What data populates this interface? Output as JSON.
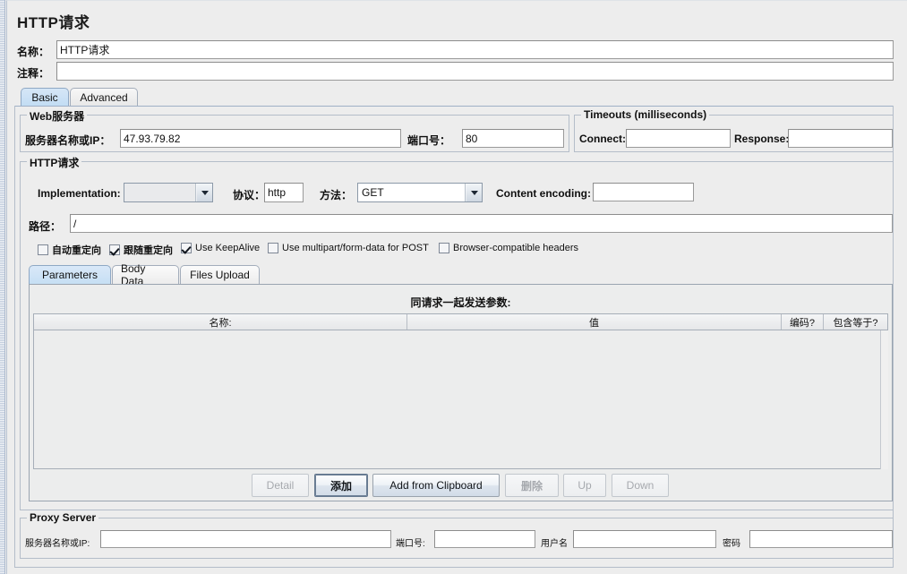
{
  "window": {
    "title": "HTTP请求"
  },
  "header": {
    "name_label": "名称：",
    "name_value": "HTTP请求",
    "comment_label": "注释：",
    "comment_value": ""
  },
  "tabs": [
    {
      "label": "Basic",
      "selected": true
    },
    {
      "label": "Advanced",
      "selected": false
    }
  ],
  "web_server": {
    "legend": "Web服务器",
    "server_label": "服务器名称或IP：",
    "server_value": "47.93.79.82",
    "port_label": "端口号：",
    "port_value": "80"
  },
  "timeouts": {
    "legend": "Timeouts (milliseconds)",
    "connect_label": "Connect:",
    "connect_value": "",
    "response_label": "Response:",
    "response_value": ""
  },
  "http_request": {
    "legend": "HTTP请求",
    "implementation_label": "Implementation:",
    "implementation_value": "",
    "protocol_label": "协议：",
    "protocol_value": "http",
    "method_label": "方法：",
    "method_value": "GET",
    "content_encoding_label": "Content encoding:",
    "content_encoding_value": "",
    "path_label": "路径：",
    "path_value": "/",
    "checkboxes": [
      {
        "label": "自动重定向",
        "checked": false,
        "cn": true
      },
      {
        "label": "跟随重定向",
        "checked": true,
        "cn": true
      },
      {
        "label": "Use KeepAlive",
        "checked": true,
        "cn": false
      },
      {
        "label": "Use multipart/form-data for POST",
        "checked": false,
        "cn": false
      },
      {
        "label": "Browser-compatible headers",
        "checked": false,
        "cn": false
      }
    ]
  },
  "param_tabs": [
    {
      "label": "Parameters",
      "selected": true
    },
    {
      "label": "Body Data",
      "selected": false
    },
    {
      "label": "Files Upload",
      "selected": false
    }
  ],
  "param_table": {
    "title": "同请求一起发送参数:",
    "columns": [
      "名称:",
      "值",
      "编码?",
      "包含等于?"
    ],
    "rows": []
  },
  "table_buttons": [
    {
      "label": "Detail",
      "enabled": false,
      "focused": false,
      "cn": false
    },
    {
      "label": "添加",
      "enabled": true,
      "focused": true,
      "cn": true
    },
    {
      "label": "Add from Clipboard",
      "enabled": true,
      "focused": false,
      "cn": false
    },
    {
      "label": "删除",
      "enabled": false,
      "focused": false,
      "cn": true
    },
    {
      "label": "Up",
      "enabled": false,
      "focused": false,
      "cn": false
    },
    {
      "label": "Down",
      "enabled": false,
      "focused": false,
      "cn": false
    }
  ],
  "proxy": {
    "legend": "Proxy Server",
    "server_label": "服务器名称或IP:",
    "server_value": "",
    "port_label": "端口号:",
    "port_value": "",
    "username_label": "用户名",
    "username_value": "",
    "password_label": "密码",
    "password_value": ""
  },
  "colors": {
    "background": "#ededed",
    "selected_tab": "#c9e0f5",
    "field_background": "#ffffff",
    "border": "#b4bdc9"
  }
}
